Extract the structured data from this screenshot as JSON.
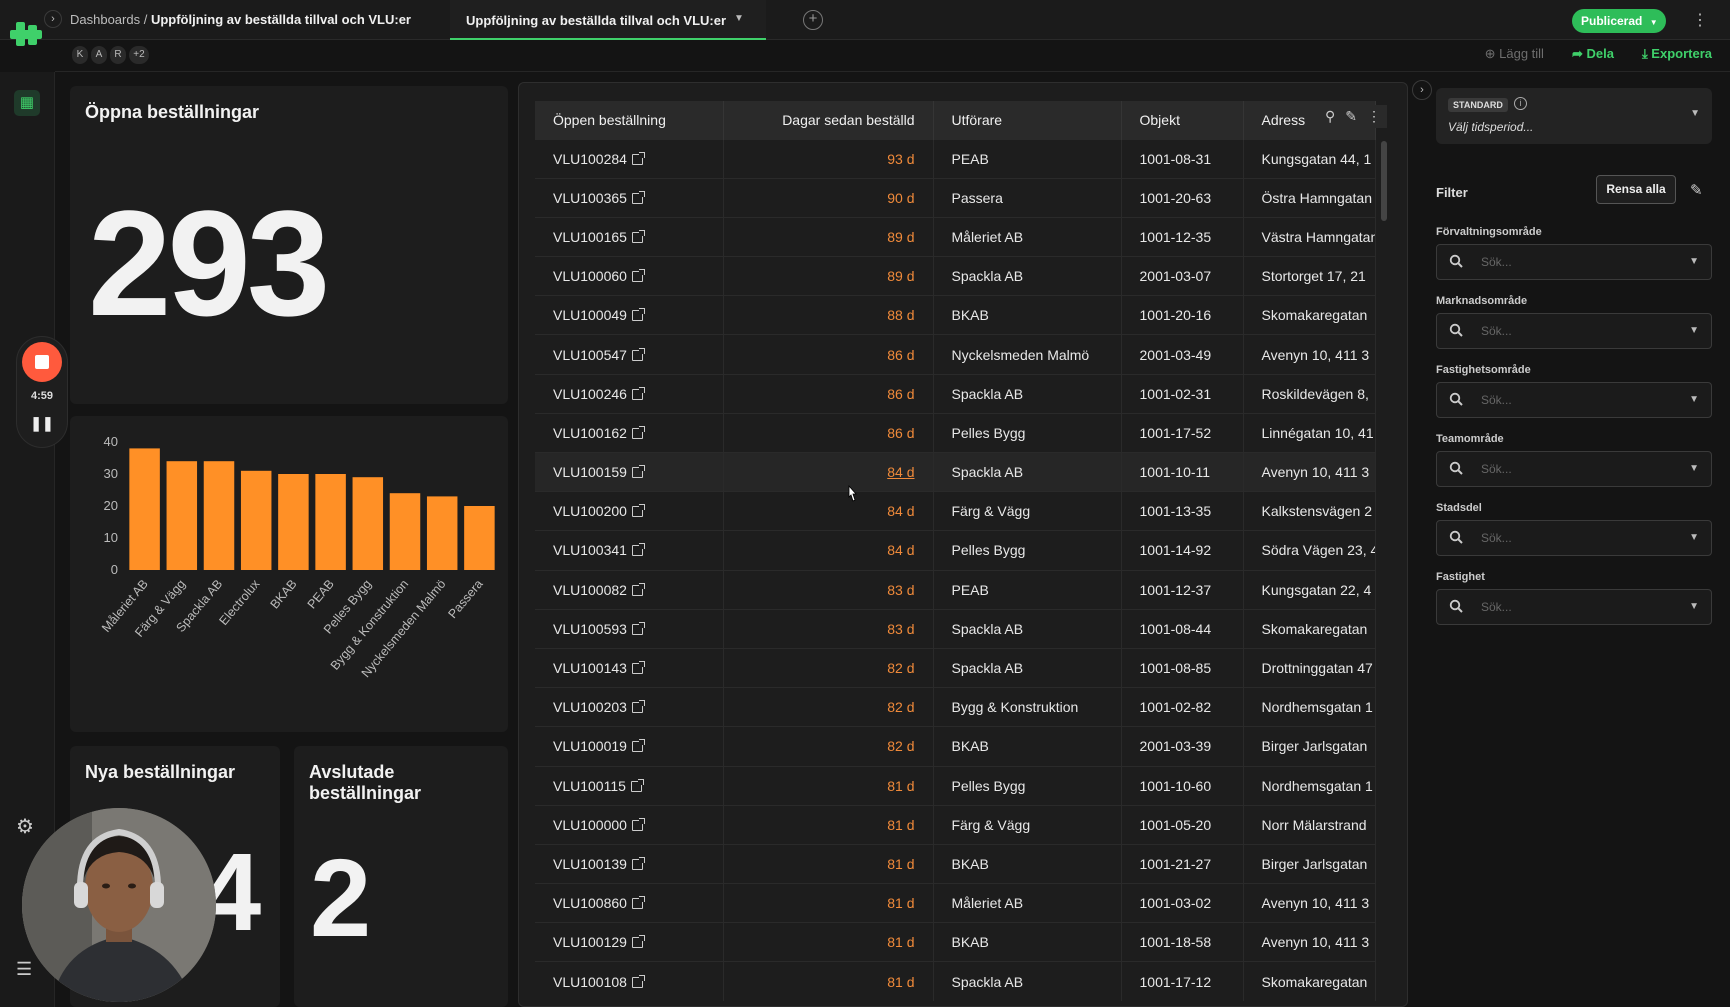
{
  "topbar": {
    "breadcrumb_root": "Dashboards /",
    "breadcrumb_current": "Uppföljning av beställda tillval och VLU:er",
    "tab_label": "Uppföljning av beställda tillval och VLU:er",
    "publish_label": "Publicerad",
    "accent": "#3fd06a"
  },
  "subbar": {
    "avatars": [
      "K",
      "A",
      "R",
      "+2"
    ],
    "add_label": "Lägg till",
    "share_label": "Dela",
    "export_label": "Exportera"
  },
  "recorder": {
    "time": "4:59"
  },
  "open_orders": {
    "title": "Öppna beställningar",
    "value": "293"
  },
  "chart_data": {
    "type": "bar",
    "categories": [
      "Måleriet AB",
      "Färg & Vägg",
      "Spackla AB",
      "Electrolux",
      "BKAB",
      "PEAB",
      "Pelles Bygg",
      "Bygg & Konstruktion",
      "Nyckelsmeden Malmö",
      "Passera"
    ],
    "values": [
      38,
      34,
      34,
      31,
      30,
      30,
      29,
      24,
      23,
      20
    ],
    "ylim": [
      0,
      40
    ],
    "yticks": [
      0,
      10,
      20,
      30,
      40
    ],
    "color": "#ff9026"
  },
  "new_orders": {
    "title": "Nya beställningar",
    "value": "4"
  },
  "closed_orders": {
    "title": "Avslutade beställningar",
    "value": "2"
  },
  "table": {
    "headers": [
      "Öppen beställning",
      "Dagar sedan beställd",
      "Utförare",
      "Objekt",
      "Adress"
    ],
    "rows": [
      [
        "VLU100284",
        "93 d",
        "PEAB",
        "1001-08-31",
        "Kungsgatan 44, 1"
      ],
      [
        "VLU100365",
        "90 d",
        "Passera",
        "1001-20-63",
        "Östra Hamngatan"
      ],
      [
        "VLU100165",
        "89 d",
        "Måleriet AB",
        "1001-12-35",
        "Västra Hamngatan"
      ],
      [
        "VLU100060",
        "89 d",
        "Spackla AB",
        "2001-03-07",
        "Stortorget 17, 21"
      ],
      [
        "VLU100049",
        "88 d",
        "BKAB",
        "1001-20-16",
        "Skomakaregatan"
      ],
      [
        "VLU100547",
        "86 d",
        "Nyckelsmeden Malmö",
        "2001-03-49",
        "Avenyn 10, 411 3"
      ],
      [
        "VLU100246",
        "86 d",
        "Spackla AB",
        "1001-02-31",
        "Roskildevägen 8,"
      ],
      [
        "VLU100162",
        "86 d",
        "Pelles Bygg",
        "1001-17-52",
        "Linnégatan 10, 41"
      ],
      [
        "VLU100159",
        "84 d",
        "Spackla AB",
        "1001-10-11",
        "Avenyn 10, 411 3"
      ],
      [
        "VLU100200",
        "84 d",
        "Färg & Vägg",
        "1001-13-35",
        "Kalkstensvägen 2"
      ],
      [
        "VLU100341",
        "84 d",
        "Pelles Bygg",
        "1001-14-92",
        "Södra Vägen 23, 4"
      ],
      [
        "VLU100082",
        "83 d",
        "PEAB",
        "1001-12-37",
        "Kungsgatan 22, 4"
      ],
      [
        "VLU100593",
        "83 d",
        "Spackla AB",
        "1001-08-44",
        "Skomakaregatan"
      ],
      [
        "VLU100143",
        "82 d",
        "Spackla AB",
        "1001-08-85",
        "Drottninggatan 47"
      ],
      [
        "VLU100203",
        "82 d",
        "Bygg & Konstruktion",
        "1001-02-82",
        "Nordhemsgatan 1"
      ],
      [
        "VLU100019",
        "82 d",
        "BKAB",
        "2001-03-39",
        "Birger Jarlsgatan"
      ],
      [
        "VLU100115",
        "81 d",
        "Pelles Bygg",
        "1001-10-60",
        "Nordhemsgatan 1"
      ],
      [
        "VLU100000",
        "81 d",
        "Färg & Vägg",
        "1001-05-20",
        "Norr Mälarstrand"
      ],
      [
        "VLU100139",
        "81 d",
        "BKAB",
        "1001-21-27",
        "Birger Jarlsgatan"
      ],
      [
        "VLU100860",
        "81 d",
        "Måleriet AB",
        "1001-03-02",
        "Avenyn 10, 411 3"
      ],
      [
        "VLU100129",
        "81 d",
        "BKAB",
        "1001-18-58",
        "Avenyn 10, 411 3"
      ],
      [
        "VLU100108",
        "81 d",
        "Spackla AB",
        "1001-17-12",
        "Skomakaregatan"
      ]
    ],
    "highlighted_row": 8
  },
  "sidepanel": {
    "badge": "STANDARD",
    "period_placeholder": "Välj tidsperiod...",
    "filter_title": "Filter",
    "clear_label": "Rensa alla",
    "filters": [
      {
        "label": "Förvaltningsområde",
        "placeholder": "Sök..."
      },
      {
        "label": "Marknadsområde",
        "placeholder": "Sök..."
      },
      {
        "label": "Fastighetsområde",
        "placeholder": "Sök..."
      },
      {
        "label": "Teamområde",
        "placeholder": "Sök..."
      },
      {
        "label": "Stadsdel",
        "placeholder": "Sök..."
      },
      {
        "label": "Fastighet",
        "placeholder": "Sök..."
      }
    ]
  }
}
